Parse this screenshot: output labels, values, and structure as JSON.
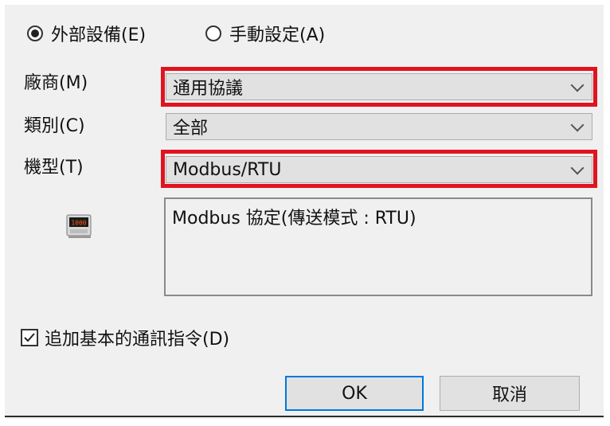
{
  "source_group": {
    "options": [
      {
        "label": "外部設備(E)",
        "selected": true
      },
      {
        "label": "手動設定(A)",
        "selected": false
      }
    ]
  },
  "fields": {
    "vendor": {
      "label": "廠商(M)",
      "value": "通用協議"
    },
    "category": {
      "label": "類別(C)",
      "value": "全部"
    },
    "model": {
      "label": "機型(T)",
      "value": "Modbus/RTU"
    }
  },
  "description": "Modbus 協定(傳送模式 : RTU)",
  "device_icon": {
    "name": "device-display-icon",
    "display_text": "1000"
  },
  "add_commands": {
    "label": "追加基本的通訊指令(D)",
    "checked": true
  },
  "buttons": {
    "ok": "OK",
    "cancel": "取消"
  },
  "colors": {
    "highlight": "#e0141e",
    "default_button_border": "#0078d7",
    "dialog_bg": "#f0f0f0"
  }
}
